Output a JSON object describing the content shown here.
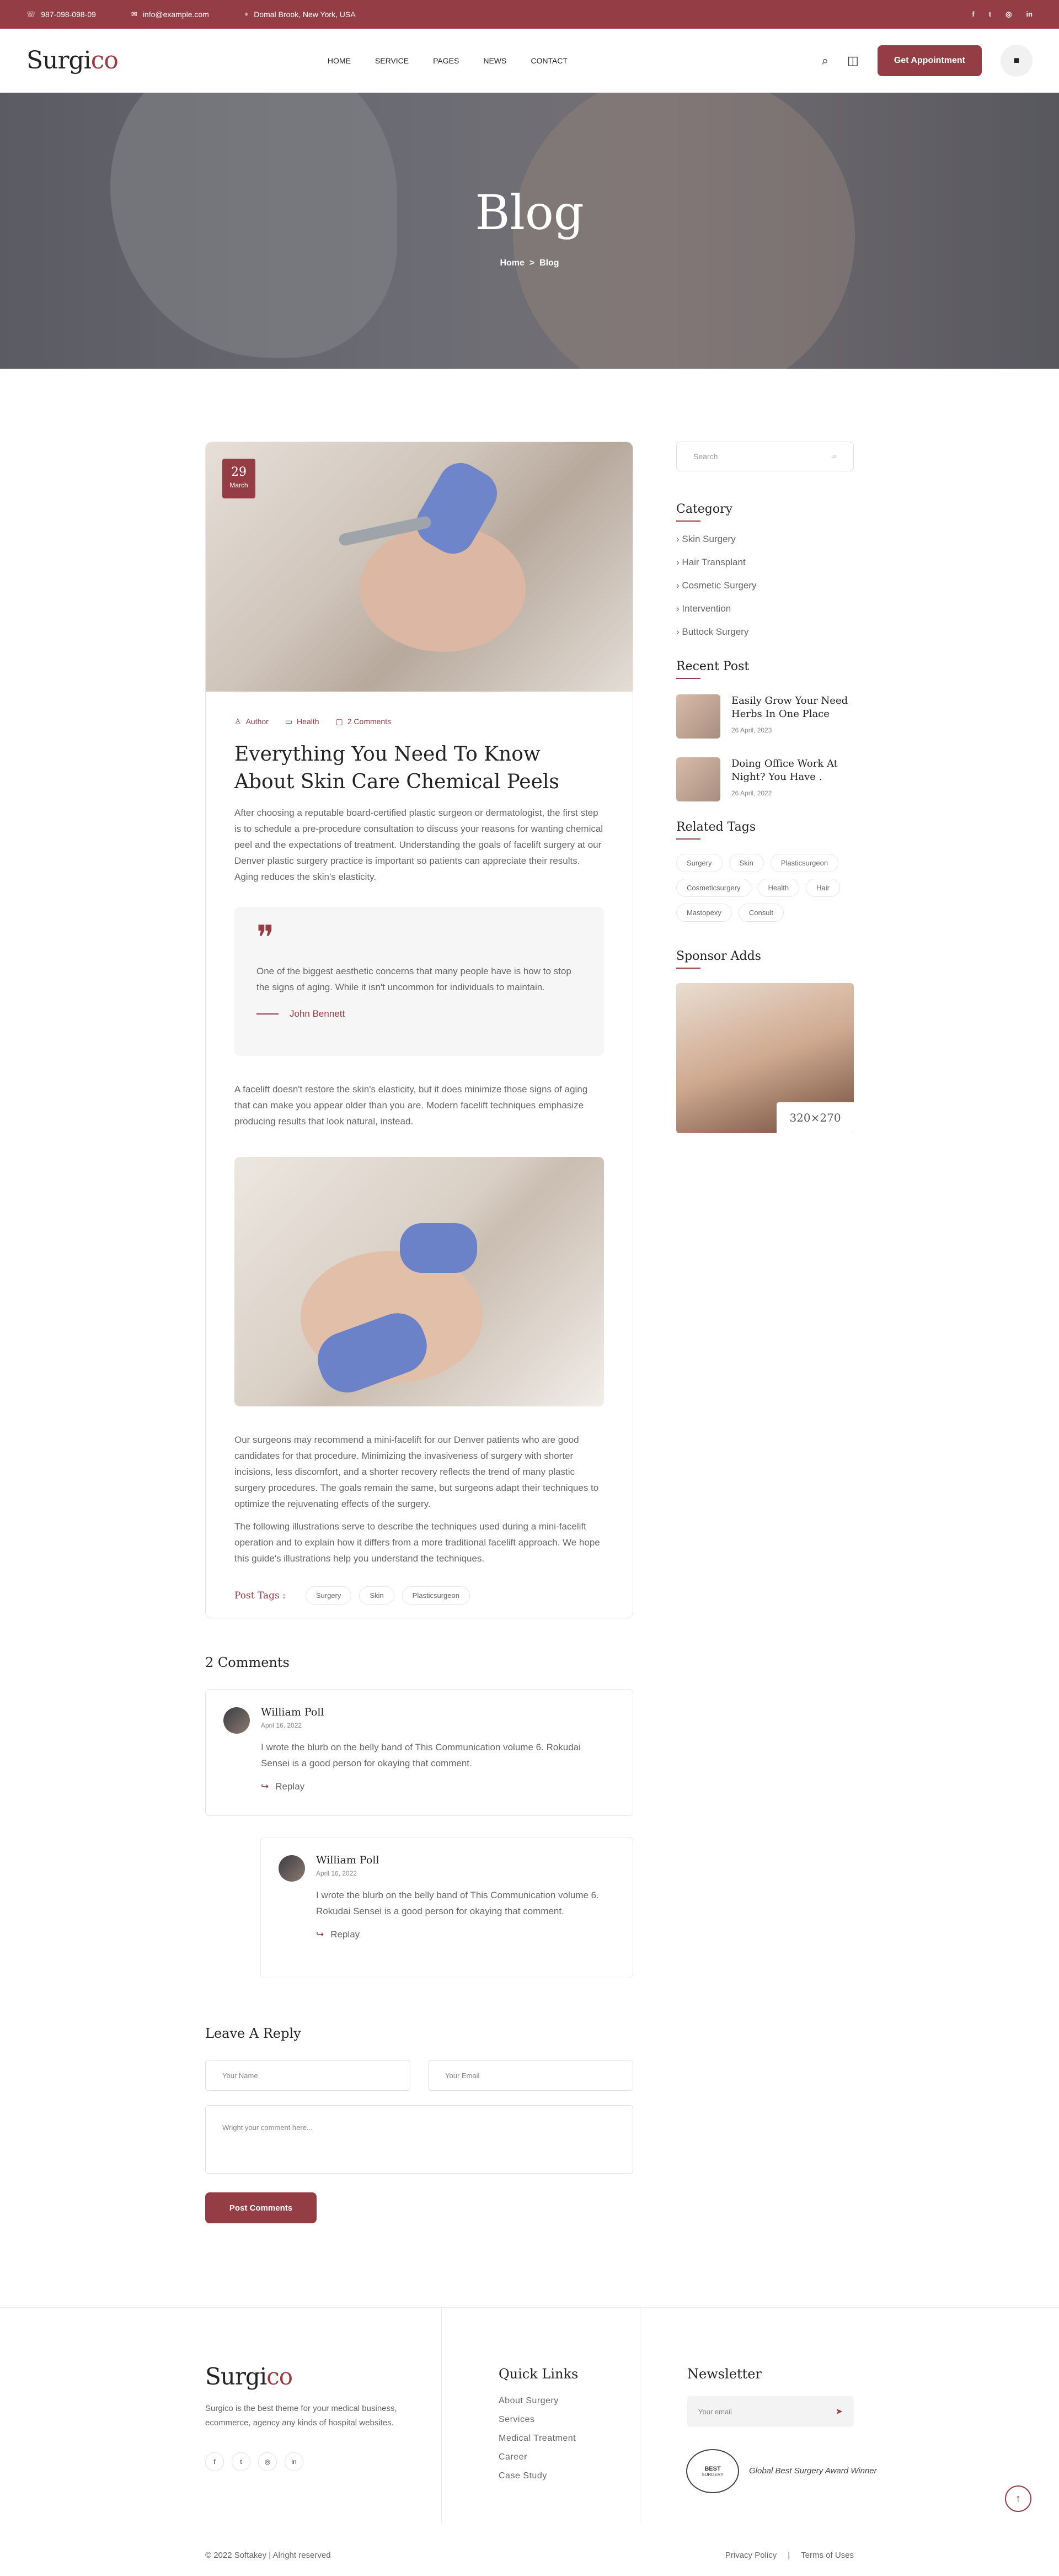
{
  "topbar": {
    "phone": "987-098-098-09",
    "email": "info@example.com",
    "address": "Domal Brook, New York, USA",
    "socials": [
      "f",
      "t",
      "◎",
      "in"
    ]
  },
  "header": {
    "logo_main": "Surgi",
    "logo_accent": "co",
    "nav": [
      "HOME",
      "SERVICE",
      "PAGES",
      "NEWS",
      "CONTACT"
    ],
    "appointment_label": "Get Appointment"
  },
  "hero": {
    "title": "Blog",
    "breadcrumb_home": "Home",
    "breadcrumb_sep": ">",
    "breadcrumb_current": "Blog"
  },
  "post": {
    "day": "29",
    "month": "March",
    "meta_author": "Author",
    "meta_category": "Health",
    "meta_comments": "2 Comments",
    "title": "Everything You Need To Know About Skin Care Chemical Peels",
    "intro": "After choosing a reputable board-certified plastic surgeon or dermatologist, the first step is to schedule a pre-procedure consultation to discuss your reasons for wanting chemical peel and the expectations of treatment. Understanding the goals of facelift surgery at our Denver plastic surgery practice is important so patients can appreciate their results. Aging reduces the skin's elasticity.",
    "quote": "One of the biggest aesthetic concerns that many people have is how to stop the signs of aging. While it isn't uncommon for individuals to maintain.",
    "quote_author": "John Bennett",
    "para2": "A facelift doesn't restore the skin's elasticity, but it does minimize those signs of aging that can make you appear older than you are. Modern facelift techniques emphasize producing results that look natural, instead.",
    "para3": "Our surgeons may recommend a mini-facelift for our Denver patients who are good candidates for that procedure. Minimizing the invasiveness of surgery with shorter incisions, less discomfort, and a shorter recovery reflects the trend of many plastic surgery procedures. The goals remain the same, but surgeons adapt their techniques to optimize the rejuvenating effects of the surgery.",
    "para4": "The following illustrations serve to describe the techniques used during a mini-facelift operation and to explain how it differs from a more traditional facelift approach. We hope this guide's illustrations help you understand the techniques.",
    "tags_label": "Post Tags :",
    "tags": [
      "Surgery",
      "Skin",
      "Plasticsurgeon"
    ]
  },
  "sidebar": {
    "search_placeholder": "Search",
    "category_title": "Category",
    "categories": [
      "Skin Surgery",
      "Hair Transplant",
      "Cosmetic Surgery",
      "Intervention",
      "Buttock Surgery"
    ],
    "recent_title": "Recent Post",
    "recent": [
      {
        "title": "Easily Grow Your Need Herbs In One Place",
        "date": "26 April, 2023"
      },
      {
        "title": "Doing Office Work At Night? You Have .",
        "date": "26 April, 2022"
      }
    ],
    "tags_title": "Related Tags",
    "tags": [
      "Surgery",
      "Skin",
      "Plasticsurgeon",
      "Cosmeticsurgery",
      "Health",
      "Hair",
      "Mastopexy",
      "Consult"
    ],
    "sponsor_title": "Sponsor Adds",
    "sponsor_size": "320×270"
  },
  "comments": {
    "title": "2 Comments",
    "items": [
      {
        "name": "William Poll",
        "date": "April 16, 2022",
        "text": "I wrote the blurb on the belly band of This Communication volume 6. Rokudai Sensei is a good person for okaying that comment.",
        "reply": "Replay"
      },
      {
        "name": "William Poll",
        "date": "April 16, 2022",
        "text": "I wrote the blurb on the belly band of This Communication volume 6. Rokudai Sensei is a good person for okaying that comment.",
        "reply": "Replay"
      }
    ]
  },
  "reply_form": {
    "title": "Leave A Reply",
    "name_placeholder": "Your Name",
    "email_placeholder": "Your Email",
    "comment_placeholder": "Wright your comment here...",
    "submit": "Post Comments"
  },
  "footer": {
    "logo_main": "Surgi",
    "logo_accent": "co",
    "description": "Surgico is the best theme for your medical business, ecommerce, agency any kinds of hospital websites.",
    "socials": [
      "f",
      "t",
      "◎",
      "in"
    ],
    "links_title": "Quick Links",
    "links": [
      "About Surgery",
      "Services",
      "Medical Treatment",
      "Career",
      "Case Study"
    ],
    "newsletter_title": "Newsletter",
    "newsletter_placeholder": "Your email",
    "award_badge": "BEST",
    "award_badge_sub": "SURGERY",
    "award_text": "Global Best Surgery Award Winner",
    "copyright": "© 2022 Softakey | Alright reserved",
    "privacy": "Privacy Policy",
    "divider": "|",
    "terms": "Terms of Uses"
  },
  "colors": {
    "brand": "#953d45"
  }
}
